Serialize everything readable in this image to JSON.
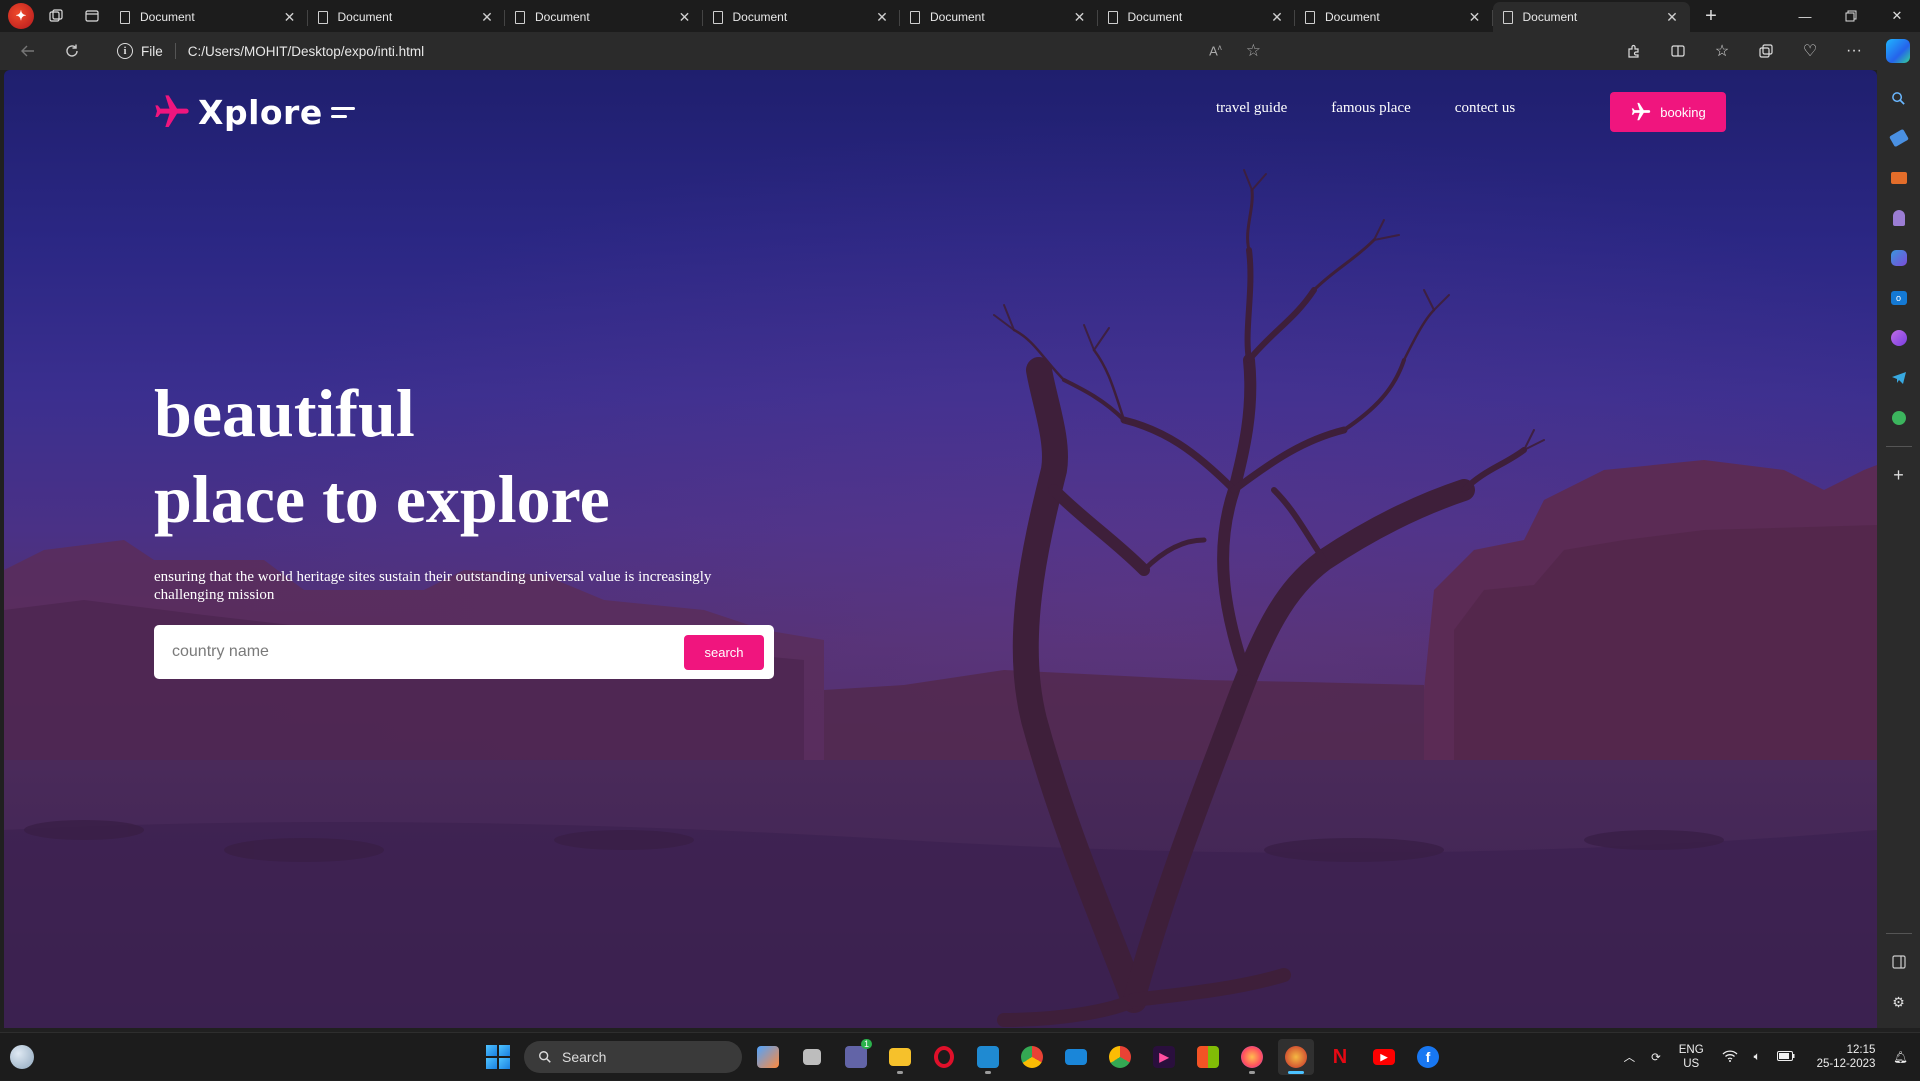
{
  "browser": {
    "tabs": [
      {
        "title": "Document"
      },
      {
        "title": "Document"
      },
      {
        "title": "Document"
      },
      {
        "title": "Document"
      },
      {
        "title": "Document"
      },
      {
        "title": "Document"
      },
      {
        "title": "Document"
      },
      {
        "title": "Document"
      }
    ],
    "active_tab_index": 7,
    "address": {
      "scheme_label": "File",
      "url": "C:/Users/MOHIT/Desktop/expo/inti.html"
    }
  },
  "site": {
    "logo_text": "Xplore",
    "nav_links": [
      "travel guide",
      "famous place",
      "contect us"
    ],
    "booking_label": "booking",
    "hero_line1": "beautiful",
    "hero_line2": "place to explore",
    "hero_text": "ensuring that the world heritage sites sustain their outstanding universal value is increasingly challenging mission",
    "search_placeholder": "country name",
    "search_label": "search",
    "accent_color": "#f0157e"
  },
  "taskbar": {
    "search_label": "Search",
    "apps": [
      "file-manager-app",
      "taskview-app",
      "teams-app",
      "explorer-app",
      "opera-app",
      "vscode-app",
      "chrome-dev-app",
      "mail-app",
      "chrome-app",
      "media-app",
      "store-app",
      "firefox-app",
      "edge-canary-app",
      "netflix-app",
      "youtube-app",
      "facebook-app"
    ],
    "teams_badge": "1",
    "lang_line1": "ENG",
    "lang_line2": "US",
    "time": "12:15",
    "date": "25-12-2023"
  }
}
